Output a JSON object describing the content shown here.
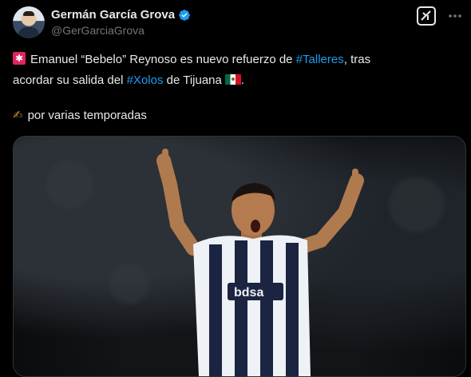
{
  "user": {
    "display_name": "Germán García Grova",
    "handle": "@GerGarciaGrova"
  },
  "tweet": {
    "line1_prefix": "Emanuel “Bebelo” Reynoso es nuevo refuerzo de ",
    "hashtag1": "#Talleres",
    "line1_suffix": ", tras",
    "line2_prefix": "acordar su salida del ",
    "hashtag2": "#Xolos",
    "line2_suffix": " de Tijuana",
    "line2_end": ".",
    "line3": "por varias temporadas"
  },
  "icons": {
    "verified": "verified-badge-icon",
    "grok": "grok-icon",
    "more": "more-options-icon",
    "siren": "rotating-light-icon",
    "flag": "mexico-flag-icon",
    "writing": "writing-hand-icon"
  },
  "colors": {
    "background": "#000000",
    "text": "#e7e9ea",
    "secondary": "#71767b",
    "link": "#1d9bf0"
  }
}
